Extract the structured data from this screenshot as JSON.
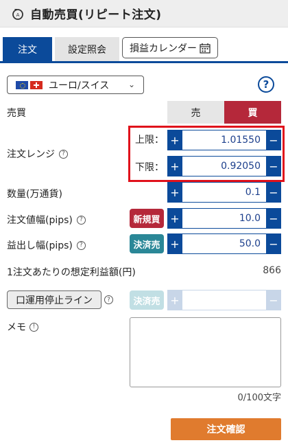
{
  "header": {
    "title": "自動売買(リピート注文)"
  },
  "tabs": [
    {
      "label": "注文"
    },
    {
      "label": "設定照会"
    },
    {
      "label": "損益カレンダー"
    }
  ],
  "pair": {
    "label": "ユーロ/スイス",
    "help": "?"
  },
  "side": {
    "label": "売買",
    "sell": "売",
    "buy": "買",
    "selected": "買"
  },
  "range": {
    "label": "注文レンジ",
    "upper_label": "上限：",
    "upper_value": "1.01550",
    "lower_label": "下限：",
    "lower_value": "0.92050"
  },
  "quantity": {
    "label": "数量(万通貨)",
    "value": "0.1"
  },
  "order_width": {
    "label": "注文値幅(pips)",
    "chip": "新規買",
    "value": "10.0"
  },
  "profit_width": {
    "label": "益出し幅(pips)",
    "chip": "決済売",
    "value": "50.0"
  },
  "estimate": {
    "label": "1注文あたりの想定利益額(円)",
    "value": "866"
  },
  "stop_line": {
    "label": "口運用停止ライン",
    "chip": "決済売",
    "value": ""
  },
  "memo": {
    "label": "メモ",
    "counter": "0/100文字"
  },
  "buttons": {
    "plus": "+",
    "minus": "−",
    "confirm": "注文確認"
  },
  "colors": {
    "primary": "#0b4a9a",
    "buy": "#b5283a",
    "close": "#2a8797",
    "confirm": "#e07b2e",
    "highlight": "#e0111b"
  }
}
